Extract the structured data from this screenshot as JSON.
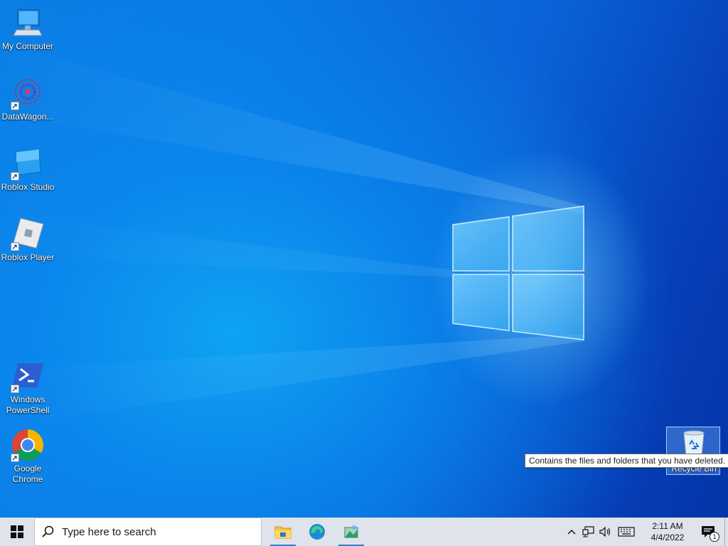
{
  "desktop": {
    "icons": [
      {
        "label": "My Computer",
        "icon": "computer-icon"
      },
      {
        "label": "DataWagon...",
        "icon": "datawagon-icon"
      },
      {
        "label": "Roblox Studio",
        "icon": "roblox-studio-icon"
      },
      {
        "label": "Roblox Player",
        "icon": "roblox-player-icon"
      },
      {
        "label": "Windows PowerShell",
        "icon": "powershell-icon"
      },
      {
        "label": "Google Chrome",
        "icon": "chrome-icon"
      }
    ],
    "recycle_bin": {
      "label": "Recycle Bin",
      "icon": "recycle-bin-icon"
    },
    "tooltip": "Contains the files and folders that you have deleted."
  },
  "taskbar": {
    "search_placeholder": "Type here to search",
    "apps": [
      {
        "name": "File Explorer",
        "icon": "file-explorer-icon"
      },
      {
        "name": "Microsoft Edge",
        "icon": "edge-icon"
      },
      {
        "name": "Image app",
        "icon": "image-app-icon"
      }
    ],
    "clock": {
      "time": "2:11 AM",
      "date": "4/4/2022"
    },
    "notification_count": "1"
  },
  "colors": {
    "taskbar_bg": "#dfe3ec",
    "accent": "#2a7fd6",
    "wallpaper": "#0a63d9"
  }
}
